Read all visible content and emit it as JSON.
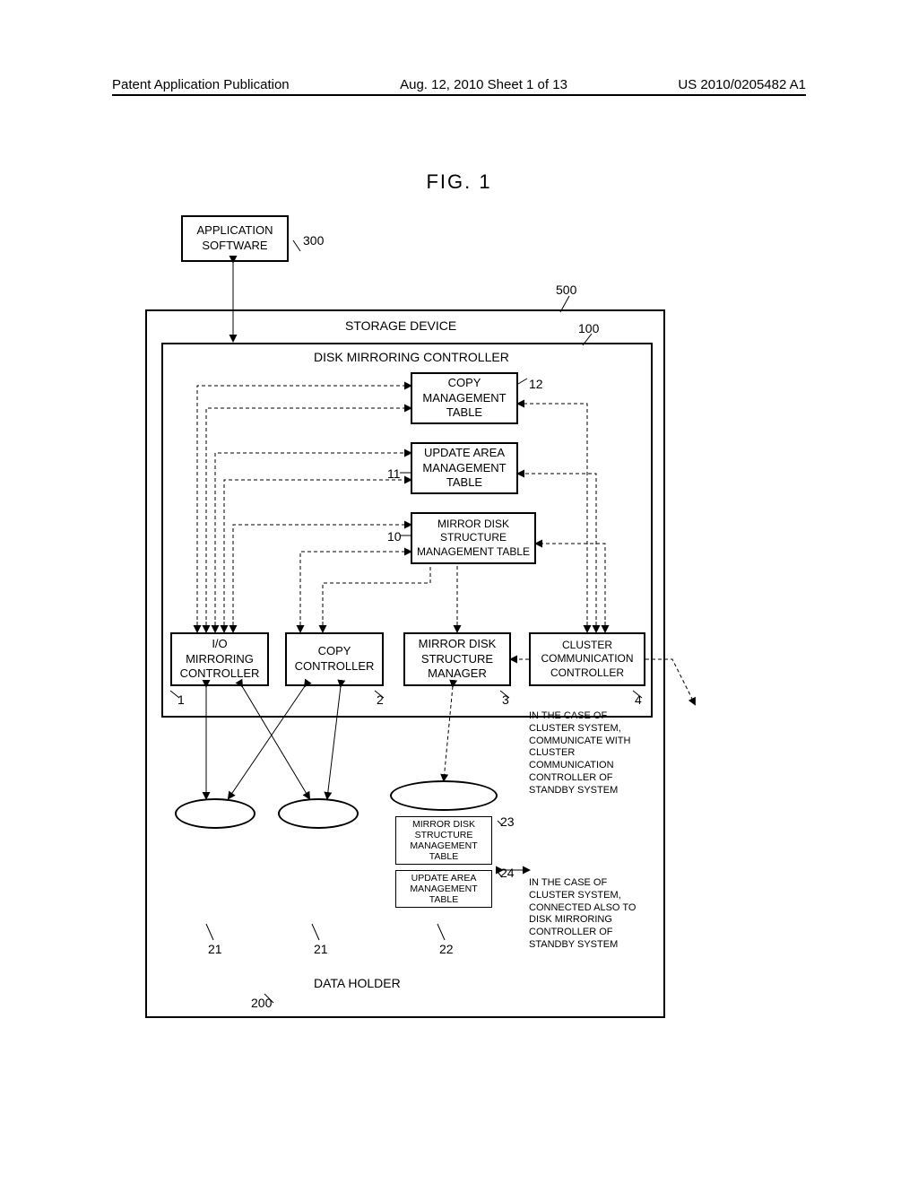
{
  "header": {
    "left": "Patent Application Publication",
    "center": "Aug. 12, 2010  Sheet 1 of 13",
    "right": "US 2010/0205482 A1"
  },
  "figure_title": "FIG. 1",
  "boxes": {
    "app_software": "APPLICATION\nSOFTWARE",
    "storage_device": "STORAGE DEVICE",
    "disk_mirroring_ctrl": "DISK MIRRORING CONTROLLER",
    "copy_mgmt": "COPY\nMANAGEMENT\nTABLE",
    "update_area_mgmt": "UPDATE AREA\nMANAGEMENT\nTABLE",
    "mirror_struct_mgmt": "MIRROR DISK\nSTRUCTURE\nMANAGEMENT TABLE",
    "io_mirror_ctrl": "I/O\nMIRRORING\nCONTROLLER",
    "copy_ctrl": "COPY\nCONTROLLER",
    "mirror_struct_mgr": "MIRROR DISK\nSTRUCTURE\nMANAGER",
    "cluster_comm_ctrl": "CLUSTER\nCOMMUNICATION\nCONTROLLER",
    "data_holder": "DATA HOLDER"
  },
  "refs": {
    "r300": "300",
    "r500": "500",
    "r100": "100",
    "r12": "12",
    "r11": "11",
    "r10": "10",
    "r1": "1",
    "r2": "2",
    "r3": "3",
    "r4": "4",
    "r21a": "21",
    "r21b": "21",
    "r22": "22",
    "r23": "23",
    "r24": "24",
    "r200": "200"
  },
  "cyl_labels": {
    "mirror_struct": "MIRROR DISK\nSTRUCTURE\nMANAGEMENT\nTABLE",
    "update_area": "UPDATE AREA\nMANAGEMENT\nTABLE"
  },
  "notes": {
    "note_top": "IN THE CASE OF\nCLUSTER SYSTEM,\nCOMMUNICATE WITH\nCLUSTER\nCOMMUNICATION\nCONTROLLER OF\nSTANDBY SYSTEM",
    "note_bottom": "IN THE CASE OF\nCLUSTER SYSTEM,\nCONNECTED ALSO TO\nDISK MIRRORING\nCONTROLLER OF\nSTANDBY SYSTEM"
  },
  "chart_data": {
    "type": "diagram",
    "title": "FIG. 1",
    "nodes": [
      {
        "id": 300,
        "label": "APPLICATION SOFTWARE"
      },
      {
        "id": 500,
        "label": "STORAGE DEVICE"
      },
      {
        "id": 100,
        "label": "DISK MIRRORING CONTROLLER",
        "parent": 500
      },
      {
        "id": 12,
        "label": "COPY MANAGEMENT TABLE",
        "parent": 100
      },
      {
        "id": 11,
        "label": "UPDATE AREA MANAGEMENT TABLE",
        "parent": 100
      },
      {
        "id": 10,
        "label": "MIRROR DISK STRUCTURE MANAGEMENT TABLE",
        "parent": 100
      },
      {
        "id": 1,
        "label": "I/O MIRRORING CONTROLLER",
        "parent": 100
      },
      {
        "id": 2,
        "label": "COPY CONTROLLER",
        "parent": 100
      },
      {
        "id": 3,
        "label": "MIRROR DISK STRUCTURE MANAGER",
        "parent": 100
      },
      {
        "id": 4,
        "label": "CLUSTER COMMUNICATION CONTROLLER",
        "parent": 100
      },
      {
        "id": 200,
        "label": "DATA HOLDER",
        "parent": 500
      },
      {
        "id": 21,
        "label": "DATA CYLINDER (x2)",
        "parent": 200
      },
      {
        "id": 22,
        "label": "CYLINDER",
        "parent": 200
      },
      {
        "id": 23,
        "label": "MIRROR DISK STRUCTURE MANAGEMENT TABLE",
        "parent": 22
      },
      {
        "id": 24,
        "label": "UPDATE AREA MANAGEMENT TABLE",
        "parent": 22
      }
    ],
    "edges": [
      {
        "from": 300,
        "to": 100,
        "style": "solid",
        "bidir": true
      },
      {
        "from": 1,
        "to": 12,
        "style": "dashed"
      },
      {
        "from": 1,
        "to": 11,
        "style": "dashed"
      },
      {
        "from": 1,
        "to": 10,
        "style": "dashed"
      },
      {
        "from": 2,
        "to": 12,
        "style": "dashed"
      },
      {
        "from": 2,
        "to": 11,
        "style": "dashed"
      },
      {
        "from": 2,
        "to": 10,
        "style": "dashed"
      },
      {
        "from": 3,
        "to": 10,
        "style": "dashed"
      },
      {
        "from": 4,
        "to": 12,
        "style": "dashed"
      },
      {
        "from": 4,
        "to": 11,
        "style": "dashed"
      },
      {
        "from": 4,
        "to": 10,
        "style": "dashed"
      },
      {
        "from": 4,
        "to": 3,
        "style": "dashed"
      },
      {
        "from": 1,
        "to": 21,
        "style": "solid",
        "bidir": true
      },
      {
        "from": 2,
        "to": 21,
        "style": "solid",
        "bidir": true
      },
      {
        "from": 3,
        "to": 22,
        "style": "dashed",
        "bidir": true
      },
      {
        "from": 4,
        "to": "external_right",
        "style": "dashed",
        "note": "communicate with cluster communication controller of standby system"
      },
      {
        "from": 22,
        "to": "external_right",
        "style": "solid",
        "bidir": true,
        "note": "connected also to disk mirroring controller of standby system"
      }
    ]
  }
}
